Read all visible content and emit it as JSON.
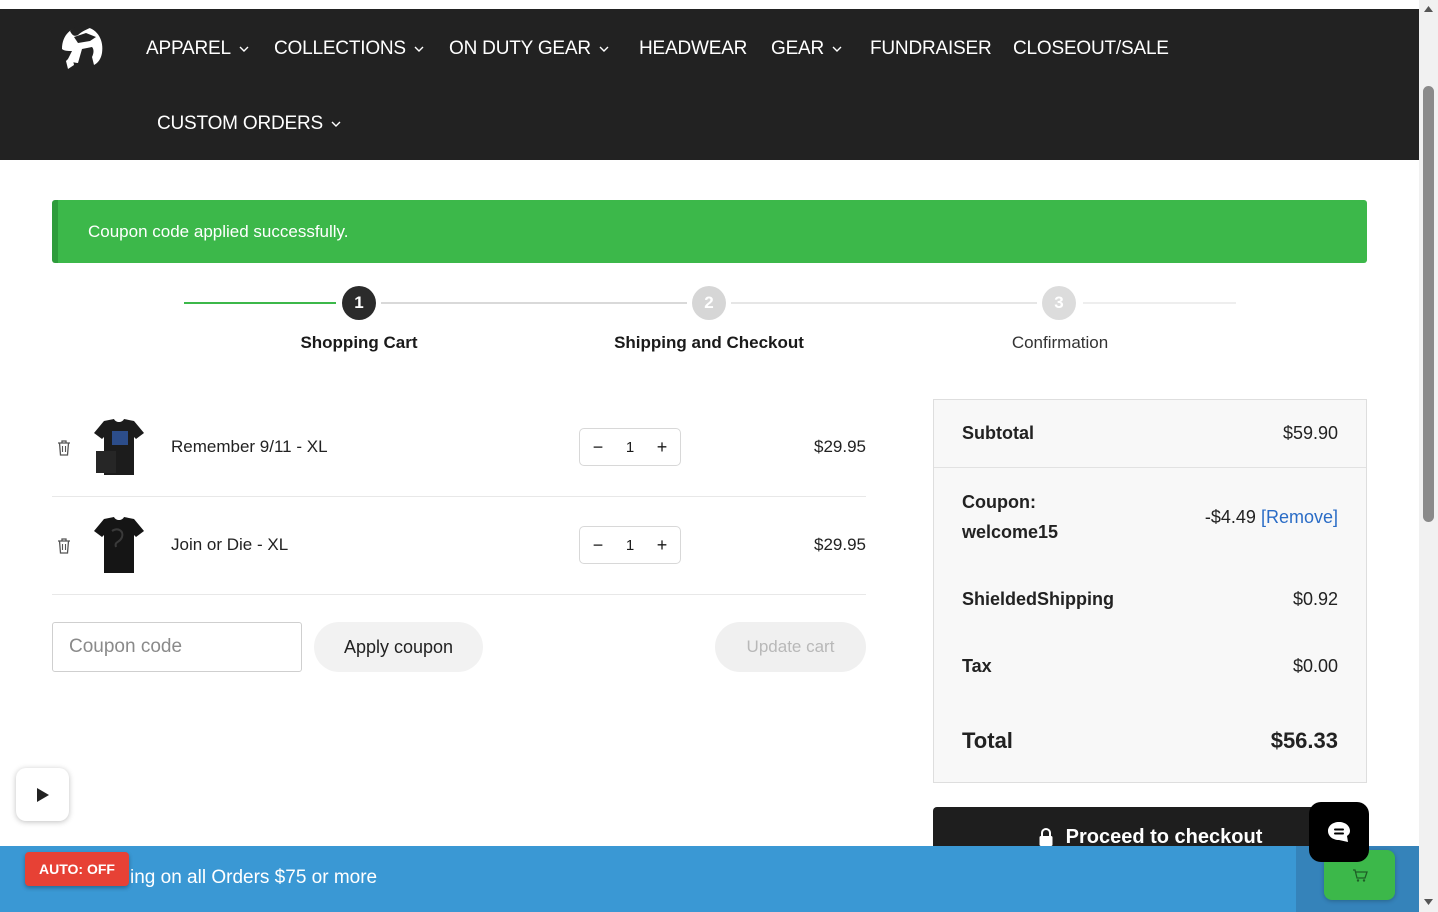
{
  "header": {
    "logo_icon": "spartan-helmet-logo",
    "nav": [
      {
        "label": "APPAREL",
        "dropdown": true
      },
      {
        "label": "COLLECTIONS",
        "dropdown": true
      },
      {
        "label": "ON DUTY GEAR",
        "dropdown": true
      },
      {
        "label": "HEADWEAR",
        "dropdown": false
      },
      {
        "label": "GEAR",
        "dropdown": true
      },
      {
        "label": "FUNDRAISER",
        "dropdown": false
      },
      {
        "label": "CLOSEOUT/SALE",
        "dropdown": false
      },
      {
        "label": "CUSTOM ORDERS",
        "dropdown": true
      }
    ]
  },
  "alert": {
    "message": "Coupon code applied successfully.",
    "color": "#3cb84a"
  },
  "steps": [
    {
      "number": "1",
      "label": "Shopping Cart",
      "state": "active"
    },
    {
      "number": "2",
      "label": "Shipping and Checkout",
      "state": "inactive"
    },
    {
      "number": "3",
      "label": "Confirmation",
      "state": "inactive"
    }
  ],
  "cart": {
    "items": [
      {
        "name": "Remember 9/11 - XL",
        "quantity": "1",
        "price": "$29.95"
      },
      {
        "name": "Join or Die - XL",
        "quantity": "1",
        "price": "$29.95"
      }
    ],
    "coupon_placeholder": "Coupon code",
    "apply_label": "Apply coupon",
    "update_label": "Update cart"
  },
  "summary": {
    "subtotal_label": "Subtotal",
    "subtotal_value": "$59.90",
    "coupon_label_line1": "Coupon:",
    "coupon_label_line2": "welcome15",
    "coupon_value": "-$4.49",
    "coupon_remove": "[Remove]",
    "shipping_label": "ShieldedShipping",
    "shipping_value": "$0.92",
    "tax_label": "Tax",
    "tax_value": "$0.00",
    "total_label": "Total",
    "total_value": "$56.33",
    "checkout_label": "Proceed to checkout"
  },
  "promo": {
    "text": "ing on all Orders $75 or more",
    "auto_badge": "AUTO: OFF"
  },
  "colors": {
    "header_bg": "#222222",
    "accent_green": "#3cb84a",
    "promo_blue": "#3a98d4",
    "badge_red": "#e74135",
    "link_blue": "#2a6cc6"
  }
}
